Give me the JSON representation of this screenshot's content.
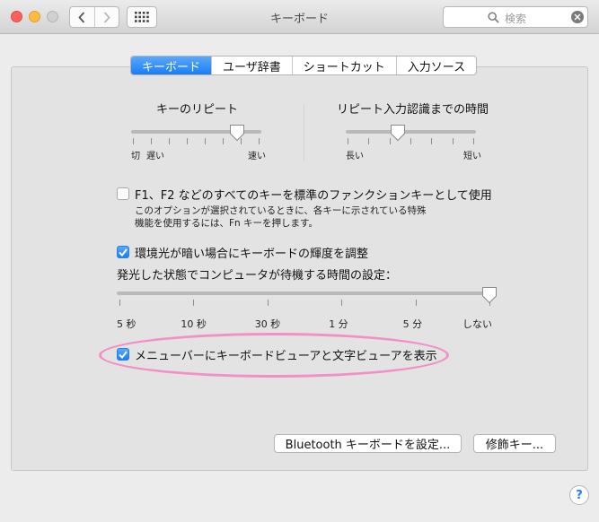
{
  "window": {
    "title": "キーボード"
  },
  "search": {
    "placeholder": "検索"
  },
  "tabs": [
    {
      "label": "キーボード",
      "active": true
    },
    {
      "label": "ユーザ辞書",
      "active": false
    },
    {
      "label": "ショートカット",
      "active": false
    },
    {
      "label": "入力ソース",
      "active": false
    }
  ],
  "key_repeat": {
    "label": "キーのリピート",
    "min_label": "切",
    "slow_label": "遅い",
    "fast_label": "速い",
    "level": 0.83
  },
  "repeat_delay": {
    "label": "リピート入力認識までの時間",
    "long_label": "長い",
    "short_label": "短い",
    "level": 0.4
  },
  "fn_keys": {
    "checked": false,
    "label": "F1、F2 などのすべてのキーを標準のファンクションキーとして使用",
    "note_line1": "このオプションが選択されているときに、各キーに示されている特殊",
    "note_line2": "機能を使用するには、Fn キーを押します。"
  },
  "backlight": {
    "checked": true,
    "label": "環境光が暗い場合にキーボードの輝度を調整"
  },
  "idle": {
    "label": "発光した状態でコンピュータが待機する時間の設定：",
    "ticks": [
      "5 秒",
      "10 秒",
      "30 秒",
      "1 分",
      "5 分",
      "しない"
    ],
    "selected_index": 5
  },
  "viewer": {
    "checked": true,
    "label": "メニューバーにキーボードビューアと文字ビューアを表示"
  },
  "buttons": {
    "bluetooth": "Bluetooth キーボードを設定...",
    "modifier": "修飾キー..."
  },
  "help": {
    "label": "?"
  },
  "colors": {
    "accent": "#1a7ef6",
    "highlight": "#f48fc6"
  }
}
